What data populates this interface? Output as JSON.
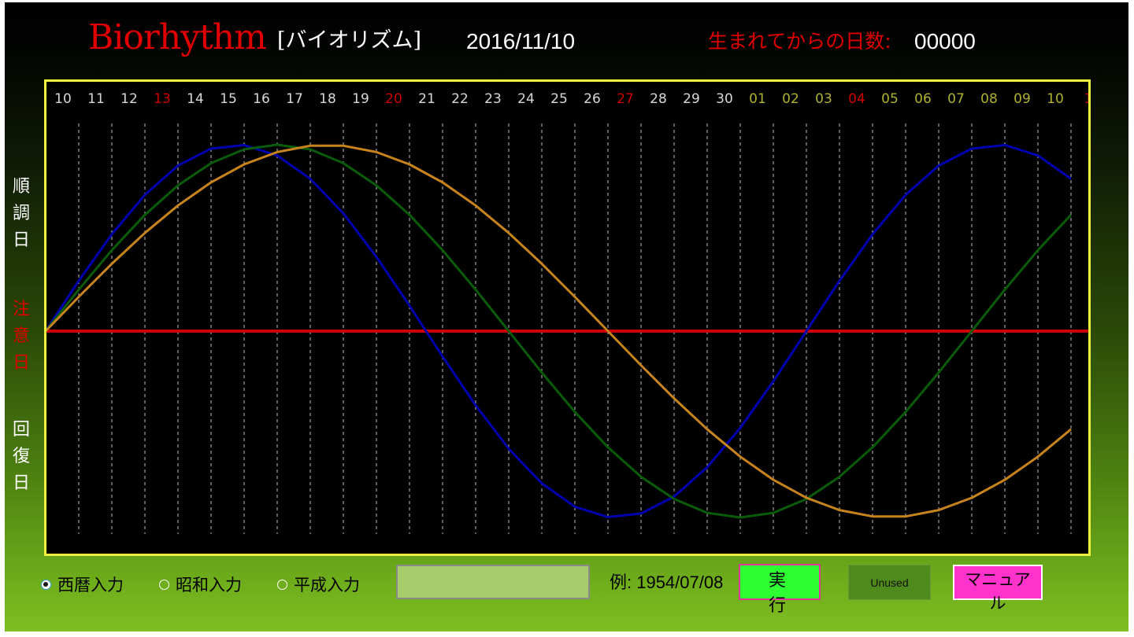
{
  "header": {
    "title": "Biorhythm",
    "subtitle": "[バイオリズム]",
    "date": "2016/11/10",
    "days_label": "生まれてからの日数:",
    "days_value": "00000"
  },
  "side_labels": {
    "good": "順\n調\n日",
    "caution": "注\n意\n日",
    "recovery": "回\n復\n日"
  },
  "colors": {
    "title": "#e00000",
    "weekday_label": "#d8d8d8",
    "sunday_label": "#cc0000",
    "next_month_label": "#b0b030",
    "frame": "#f0f040",
    "baseline": "#cc0000",
    "gridline": "#bfbfbf",
    "physical": "#0000b0",
    "emotional": "#0a5c0a",
    "intellectual": "#c8841c"
  },
  "chart_data": {
    "type": "line",
    "x": [
      "10",
      "11",
      "12",
      "13",
      "14",
      "15",
      "16",
      "17",
      "18",
      "19",
      "20",
      "21",
      "22",
      "23",
      "24",
      "25",
      "26",
      "27",
      "28",
      "29",
      "30",
      "01",
      "02",
      "03",
      "04",
      "05",
      "06",
      "07",
      "08",
      "09",
      "10",
      "1"
    ],
    "x_label_kind": [
      "w",
      "w",
      "w",
      "s",
      "w",
      "w",
      "w",
      "w",
      "w",
      "w",
      "s",
      "w",
      "w",
      "w",
      "w",
      "w",
      "w",
      "s",
      "w",
      "w",
      "w",
      "n",
      "n",
      "n",
      "s",
      "n",
      "n",
      "n",
      "n",
      "n",
      "n",
      "s"
    ],
    "ylim": [
      -1,
      1
    ],
    "grid": true,
    "series": [
      {
        "color_key": "physical",
        "values": [
          0,
          0.2698,
          0.5196,
          0.7308,
          0.8879,
          0.9791,
          0.9977,
          0.9423,
          0.817,
          0.6311,
          0.3984,
          0.1362,
          -0.1362,
          -0.3984,
          -0.6311,
          -0.817,
          -0.9423,
          -0.9977,
          -0.9791,
          -0.8879,
          -0.7308,
          -0.5196,
          -0.2698,
          0,
          0.2698,
          0.5196,
          0.7308,
          0.8879,
          0.9791,
          0.9977,
          0.9423,
          0.817
        ]
      },
      {
        "color_key": "emotional",
        "values": [
          0,
          0.2225,
          0.4339,
          0.6235,
          0.7818,
          0.901,
          0.9749,
          1.0,
          0.9749,
          0.901,
          0.7818,
          0.6235,
          0.4339,
          0.2225,
          0,
          -0.2225,
          -0.4339,
          -0.6235,
          -0.7818,
          -0.901,
          -0.9749,
          -1.0,
          -0.9749,
          -0.901,
          -0.7818,
          -0.6235,
          -0.4339,
          -0.2225,
          0,
          0.2225,
          0.4339,
          0.6235
        ]
      },
      {
        "color_key": "intellectual",
        "values": [
          0,
          0.1837,
          0.3612,
          0.5264,
          0.6737,
          0.798,
          0.8947,
          0.9602,
          0.9945,
          0.9945,
          0.9602,
          0.8947,
          0.798,
          0.6737,
          0.5264,
          0.3612,
          0.1837,
          0,
          -0.1837,
          -0.3612,
          -0.5264,
          -0.6737,
          -0.798,
          -0.8947,
          -0.9602,
          -0.9945,
          -0.9945,
          -0.9602,
          -0.8947,
          -0.798,
          -0.6737,
          -0.5264
        ]
      }
    ]
  },
  "input": {
    "radio_options": [
      "西暦入力",
      "昭和入力",
      "平成入力"
    ],
    "selected_index": 0,
    "date_value": "",
    "example": "例: 1954/07/08"
  },
  "buttons": {
    "run": "実 行",
    "unused": "Unused",
    "manual": "マニュアル"
  }
}
